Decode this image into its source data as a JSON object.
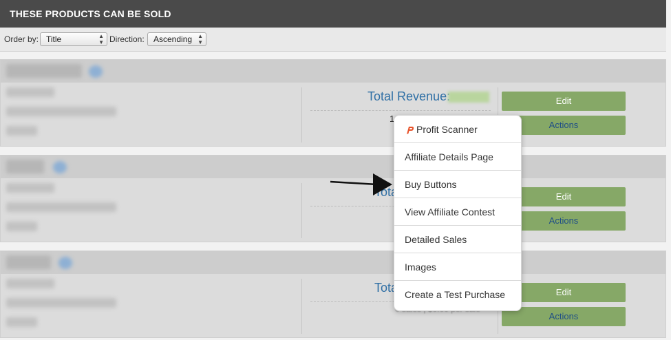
{
  "header": {
    "title": "THESE PRODUCTS CAN BE SOLD"
  },
  "order_bar": {
    "order_by_label": "Order by:",
    "order_by_value": "Title",
    "direction_label": "Direction:",
    "direction_value": "Ascending"
  },
  "products": [
    {
      "revenue_label": "Total Revenue:",
      "sales_text": "1",
      "edit_label": "Edit",
      "actions_label": "Actions"
    },
    {
      "revenue_label": "Tota",
      "edit_label": "Edit",
      "actions_label": "Actions"
    },
    {
      "revenue_label": "Tota",
      "sales_text": "0 sales | $0.00 per sale",
      "edit_label": "Edit",
      "actions_label": "Actions"
    }
  ],
  "actions_menu": {
    "items": [
      {
        "label": "Profit Scanner",
        "icon": "profit-scanner-icon"
      },
      {
        "label": "Affiliate Details Page"
      },
      {
        "label": "Buy Buttons"
      },
      {
        "label": "View Affiliate Contest"
      },
      {
        "label": "Detailed Sales"
      },
      {
        "label": "Images"
      },
      {
        "label": "Create a Test Purchase"
      }
    ]
  },
  "colors": {
    "header_bg": "#4a4a4a",
    "button_green": "#86a867",
    "link_blue": "#2f6fa5",
    "profit_icon": "#e8532b"
  }
}
